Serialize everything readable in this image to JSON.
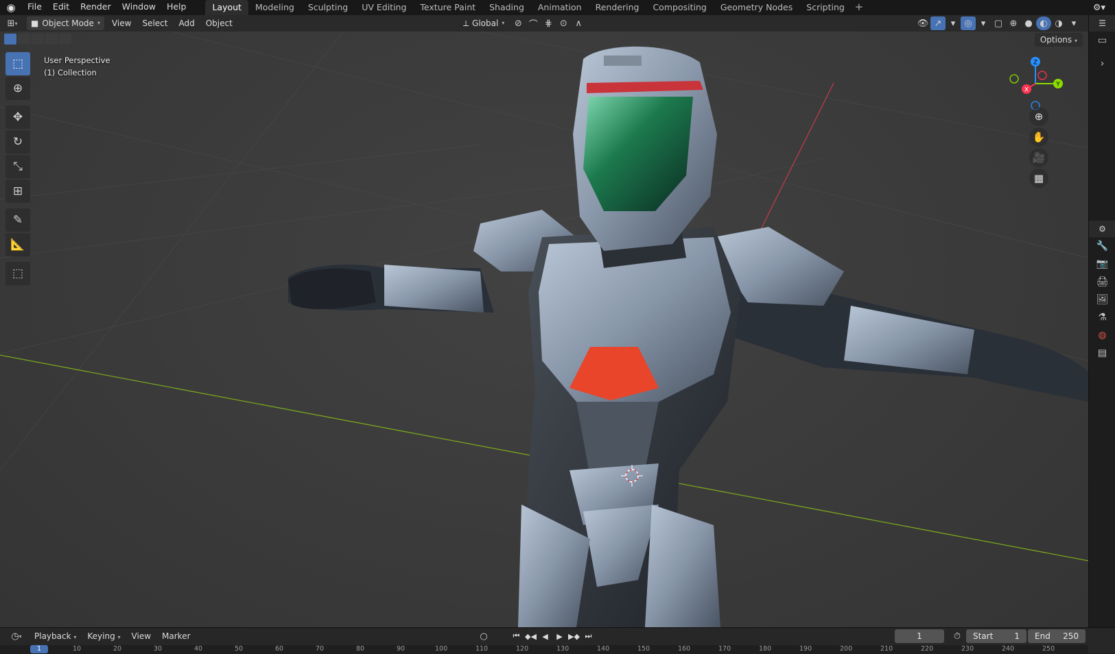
{
  "topbar": {
    "menus": [
      "File",
      "Edit",
      "Render",
      "Window",
      "Help"
    ],
    "workspaces": [
      "Layout",
      "Modeling",
      "Sculpting",
      "UV Editing",
      "Texture Paint",
      "Shading",
      "Animation",
      "Rendering",
      "Compositing",
      "Geometry Nodes",
      "Scripting"
    ],
    "active_workspace": "Layout",
    "add_tab": "+"
  },
  "viewport_header": {
    "mode": "Object Mode",
    "menus": [
      "View",
      "Select",
      "Add",
      "Object"
    ],
    "orientation": "Global",
    "options_label": "Options"
  },
  "viewport": {
    "perspective_label": "User Perspective",
    "collection_label": "(1) Collection",
    "gizmo": {
      "x": "X",
      "y": "Y",
      "z": "Z"
    },
    "tools": [
      "select-box",
      "cursor",
      "move",
      "rotate",
      "scale",
      "transform",
      "annotate",
      "measure",
      "add-cube"
    ],
    "nav_buttons": [
      "zoom",
      "pan",
      "camera",
      "ortho-toggle"
    ]
  },
  "timeline": {
    "menus": [
      "Playback",
      "Keying",
      "View",
      "Marker"
    ],
    "current_frame": "1",
    "start_label": "Start",
    "start_value": "1",
    "end_label": "End",
    "end_value": "250",
    "ruler_ticks": [
      "1",
      "10",
      "20",
      "30",
      "40",
      "50",
      "60",
      "70",
      "80",
      "90",
      "100",
      "110",
      "120",
      "130",
      "140",
      "150",
      "160",
      "170",
      "180",
      "190",
      "200",
      "210",
      "220",
      "230",
      "240",
      "250"
    ]
  },
  "colors": {
    "accent": "#4772b3",
    "x_axis": "#ff3352",
    "y_axis": "#8bdc00",
    "z_axis": "#2890ff"
  }
}
